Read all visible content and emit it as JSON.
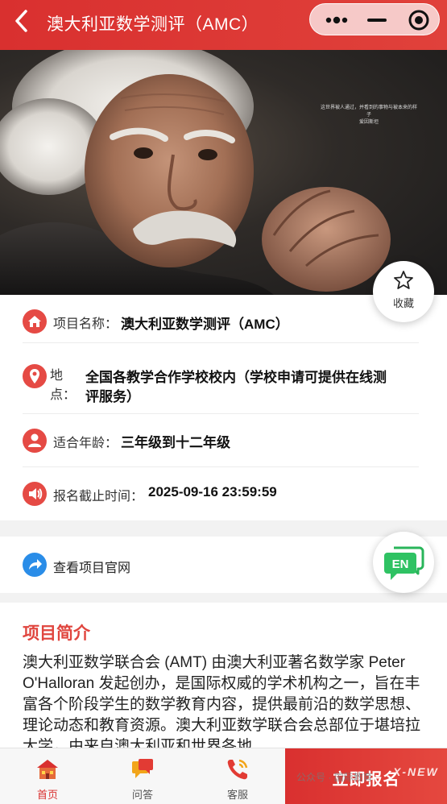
{
  "header": {
    "title": "澳大利亚数学测评（AMC）",
    "back_icon": "chevron-left-icon",
    "capsule_icons": [
      "more-dots-icon",
      "minimize-icon",
      "close-target-icon"
    ]
  },
  "hero": {
    "image": "portrait photo of elderly man with white hair, hands clasped",
    "caption": "这世界被人通过，并看到的事物与被本来的样子",
    "caption2": "爱因斯坦"
  },
  "favorite": {
    "label": "收藏",
    "icon": "star-outline-icon"
  },
  "info": {
    "project": {
      "label": "项目名称：",
      "value": "澳大利亚数学测评（AMC）",
      "icon": "home-icon"
    },
    "location": {
      "label_1": "地",
      "label_2": "点：",
      "value_line1": "全国各教学合作学校校内（学校申请可提供在线测",
      "value_line2": "评服务）",
      "icon": "location-pin-icon"
    },
    "age": {
      "label": "适合年龄：",
      "value": "三年级到十二年级",
      "icon": "user-icon"
    },
    "deadline": {
      "label": "报名截止时间：",
      "value": "2025-09-16 23:59:59",
      "icon": "speaker-icon"
    }
  },
  "official_link": {
    "label": "查看项目官网",
    "icon": "share-arrow-icon"
  },
  "language_toggle": {
    "label": "EN",
    "icon": "chat-bubble-icon"
  },
  "intro": {
    "title": "项目简介",
    "body": "澳大利亚数学联合会 (AMT) 由澳大利亚著名数学家 Peter O'Halloran 发起创办，是国际权威的学术机构之一，旨在丰富各个阶段学生的数学教育内容，提供最前沿的数学思想、理论动态和教育资源。澳大利亚数学联合会总部位于堪培拉大学，由来自澳大利亚和世界各地"
  },
  "tabbar": {
    "tabs": [
      {
        "label": "首页",
        "icon": "house-icon"
      },
      {
        "label": "问答",
        "icon": "chat-icon"
      },
      {
        "label": "客服",
        "icon": "phone-icon"
      }
    ],
    "cta_label": "立即报名"
  },
  "watermark": {
    "text": "公众号 · 国际教育",
    "logo": "X-NEW"
  },
  "colors": {
    "brand_red": "#d9302f",
    "link_blue": "#2a8de8",
    "icon_red": "#e54a44"
  }
}
